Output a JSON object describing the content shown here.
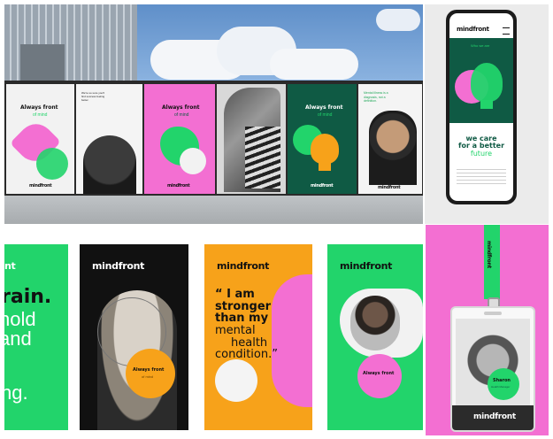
{
  "colors": {
    "green": "#22d46b",
    "dark_green": "#0f5a44",
    "pink": "#f36fd2",
    "orange": "#f7a21a",
    "black": "#111111",
    "grey": "#ececec"
  },
  "billboard": {
    "posters": [
      {
        "headline": "Always front",
        "sub": "of mind",
        "brand": "mindfront"
      },
      {
        "text": "We're so sure you'll find success feeling better."
      },
      {
        "headline": "Always front",
        "sub": "of mind",
        "brand": "mindfront"
      },
      {
        "text": ""
      },
      {
        "headline": "Always front",
        "sub": "of mind",
        "brand": "mindfront"
      },
      {
        "text": "Mental illness is a diagnosis, not a definition.",
        "brand": "mindfront"
      }
    ]
  },
  "phone": {
    "brand": "mindfront",
    "tagline": "Who we are",
    "headline_1": "we care",
    "headline_2": "for a better",
    "headline_3": "future"
  },
  "bottom_posters": {
    "left_fragment": {
      "lines": [
        "rain.",
        "hold",
        "and",
        "ng."
      ]
    },
    "girl": {
      "brand": "mindfront",
      "bubble": "Always front",
      "bubble_sub": "of mind"
    },
    "quote": {
      "brand": "mindfront",
      "quote_mark": "“",
      "line1": "I am",
      "line2": "stronger",
      "line3": "than my",
      "line4": "mental",
      "line5": "health",
      "line6": "condition.",
      "end_mark": "”"
    },
    "child": {
      "brand": "mindfront",
      "bubble": "Always front"
    },
    "badge": {
      "lanyard": "mindfront",
      "name": "Sharon",
      "role": "Health Manager",
      "brand": "mindfront"
    }
  }
}
